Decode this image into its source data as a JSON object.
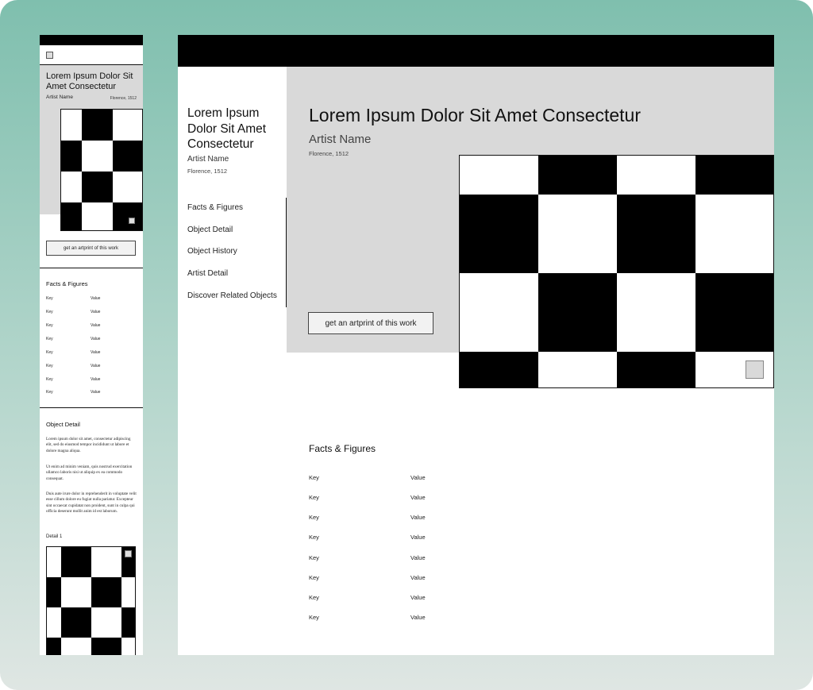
{
  "artwork": {
    "title": "Lorem Ipsum Dolor Sit Amet Consectetur",
    "artist": "Artist Name",
    "place_date": "Florence, 1512",
    "cta_label": "get an artprint of this work"
  },
  "nav": {
    "items": [
      {
        "label": "Facts & Figures"
      },
      {
        "label": "Object Detail"
      },
      {
        "label": "Object History"
      },
      {
        "label": "Artist Detail"
      },
      {
        "label": "Discover Related Objects"
      }
    ]
  },
  "facts": {
    "title": "Facts & Figures",
    "rows": [
      {
        "key": "Key",
        "value": "Value"
      },
      {
        "key": "Key",
        "value": "Value"
      },
      {
        "key": "Key",
        "value": "Value"
      },
      {
        "key": "Key",
        "value": "Value"
      },
      {
        "key": "Key",
        "value": "Value"
      },
      {
        "key": "Key",
        "value": "Value"
      },
      {
        "key": "Key",
        "value": "Value"
      },
      {
        "key": "Key",
        "value": "Value"
      }
    ]
  },
  "object_detail": {
    "title": "Object Detail",
    "paragraphs": [
      "Lorem ipsum dolor sit amet, consectetur adipiscing elit, sed do eiusmod tempor incididunt ut labore et dolore magna aliqua.",
      "Ut enim ad minim veniam, quis nostrud exercitation ullamco laboris nisi ut aliquip ex ea commodo consequat.",
      "Duis aute irure dolor in reprehenderit in voluptate velit esse cillum dolore eu fugiat nulla pariatur. Excepteur sint occaecat cupidatat non proident, sunt in culpa qui officia deserunt mollit anim id est laborum."
    ],
    "detail_label": "Detail 1"
  },
  "icons": {
    "menu": "menu-square-icon",
    "zoom": "zoom-square-icon"
  }
}
